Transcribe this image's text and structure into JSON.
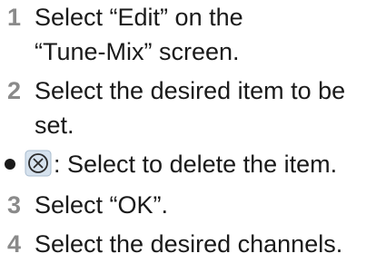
{
  "steps": [
    {
      "number": "1",
      "text": "Select “Edit” on the “Tune-Mix” screen."
    },
    {
      "number": "2",
      "text": "Select the desired item to be set."
    },
    {
      "number": "3",
      "text": "Select “OK”."
    },
    {
      "number": "4",
      "text": "Select the desired channels."
    }
  ],
  "bullet": {
    "icon": "delete-x-icon",
    "text": ": Select to delete the item."
  },
  "colors": {
    "step_number": "#8a8a8a",
    "text": "#1a1a1a",
    "icon_fill": "#d6e2ee",
    "icon_border": "#6f8fae"
  }
}
